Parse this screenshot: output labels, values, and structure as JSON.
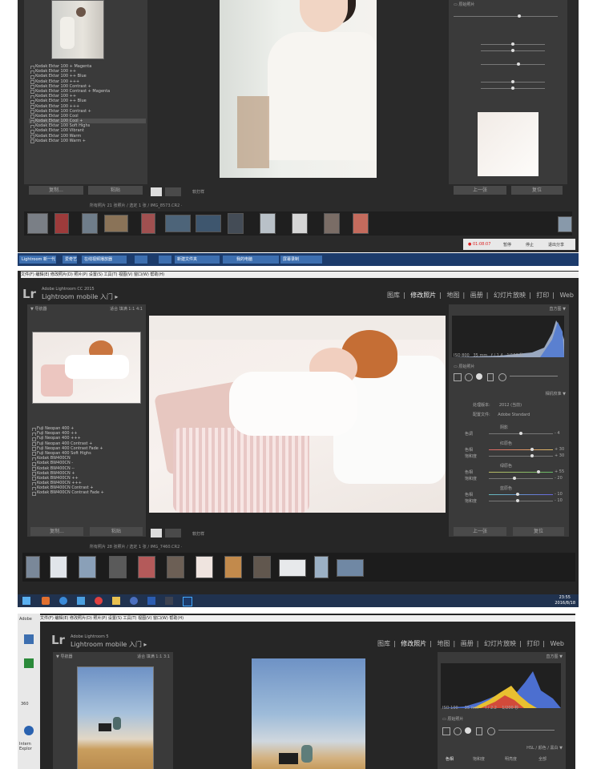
{
  "shot1": {
    "preset_list": [
      "Kodak Ektar 100 + Magenta",
      "Kodak Ektar 100 ++",
      "Kodak Ektar 100 ++ Blue",
      "Kodak Ektar 100 +++",
      "Kodak Ektar 100 Contrast +",
      "Kodak Ektar 100 Contrast + Magenta",
      "Kodak Ektar 100 ++",
      "Kodak Ektar 100 ++ Blue",
      "Kodak Ektar 100 +++",
      "Kodak Ektar 100 Contrast +",
      "Kodak Ektar 100 Cool",
      "Kodak Ektar 100 Cool +",
      "Kodak Ektar 100 Soft Highs",
      "Kodak Ektar 100 Vibrant",
      "Kodak Ektar 100 Warm",
      "Kodak Ektar 100 Warm +"
    ],
    "filmstrip_info": "所有照片   21 张照片 / 选定 1 张 / IMG_8573.CR2 ·",
    "copy_label": "复制...",
    "paste_label": "粘贴",
    "soft_proof": "软打样",
    "prev_label": "上一张",
    "reset_label": "复位",
    "recording": "● 01:08:07",
    "rec_controls": [
      "暂停",
      "停止",
      "退出分享"
    ],
    "taskbar": [
      "Lightroom 新一代",
      "爱奇艺",
      "在线视频播放器",
      "",
      "",
      "新建文件夹",
      "",
      "我的电脑",
      "屏幕录制"
    ]
  },
  "shot2": {
    "menubar": "文件(F)  编辑(E)  修改照片(D)  照片(P)  设置(S)  工具(T)  视图(V)  窗口(W)  帮助(H)",
    "app_version": "Adobe Lightroom CC 2015",
    "app_title": "Lightroom mobile 入门",
    "modules": [
      "图库",
      "修改照片",
      "地图",
      "画册",
      "幻灯片放映",
      "打印",
      "Web"
    ],
    "active_module": "修改照片",
    "navigator": "导航器",
    "nav_zoom": "适合   填满   1:1   4:1",
    "histogram": "直方图",
    "hist_readout": [
      "ISO 800",
      "35 mm",
      "f / 1.4",
      "1/160 秒"
    ],
    "original_photo": "原始照片",
    "camera_calibration": "相机校准",
    "process_label": "处理版本:",
    "process_value": "2012 (当前)",
    "profile_label": "配置文件:",
    "profile_value": "Adobe Standard",
    "sections": [
      {
        "title": "阴影",
        "rows": [
          {
            "label": "色调",
            "value": "- 4"
          }
        ]
      },
      {
        "title": "红原色",
        "rows": [
          {
            "label": "色相",
            "value": "+ 30"
          },
          {
            "label": "饱和度",
            "value": "+ 30"
          }
        ]
      },
      {
        "title": "绿原色",
        "rows": [
          {
            "label": "色相",
            "value": "+ 55"
          },
          {
            "label": "饱和度",
            "value": "- 20"
          }
        ]
      },
      {
        "title": "蓝原色",
        "rows": [
          {
            "label": "色相",
            "value": "- 10"
          },
          {
            "label": "饱和度",
            "value": "- 10"
          }
        ]
      }
    ],
    "preset_list": [
      "Fuji Neopan 400 +",
      "Fuji Neopan 400 ++",
      "Fuji Neopan 400 +++",
      "Fuji Neopan 400 Contrast +",
      "Fuji Neopan 400 Contrast Fade +",
      "Fuji Neopan 400 Soft Highs",
      "Kodak BW400CN",
      "Kodak BW400CN -",
      "Kodak BW400CN --",
      "Kodak BW400CN +",
      "Kodak BW400CN ++",
      "Kodak BW400CN +++",
      "Kodak BW400CN Contrast +",
      "Kodak BW400CN Contrast Fade +"
    ],
    "copy_label": "复制...",
    "paste_label": "粘贴",
    "soft_proof": "软打样",
    "prev_label": "上一张",
    "reset_label": "复位",
    "filmstrip_info": "所有照片   28 张照片 / 选定 1 张 / IMG_7460.CR2 ·",
    "clock_time": "23:55",
    "clock_date": "2016/8/18"
  },
  "shot3": {
    "menubar": "文件(F)  编辑(E)  修改照片(D)  照片(P)  设置(S)  工具(T)  视图(V)  窗口(W)  帮助(H)",
    "app_version": "Adobe Lightroom 5",
    "app_title": "Lightroom mobile 入门",
    "modules": [
      "图库",
      "修改照片",
      "地图",
      "画册",
      "幻灯片放映",
      "打印",
      "Web"
    ],
    "active_module": "修改照片",
    "navigator": "导航器",
    "nav_zoom": "适合   填满   1:1   3:1",
    "histogram": "直方图",
    "hist_readout": [
      "ISO 100",
      "35 mm",
      "f / 2.2",
      "1/200 秒"
    ],
    "original_photo": "原始照片",
    "hsl_header": "HSL  /  颜色  /  黑白",
    "hsl_tabs": [
      "色相",
      "饱和度",
      "明亮度",
      "全部"
    ],
    "desktop_icons": [
      "Adobe",
      "",
      "",
      "360",
      "",
      "Intern Explor",
      "",
      ""
    ]
  }
}
